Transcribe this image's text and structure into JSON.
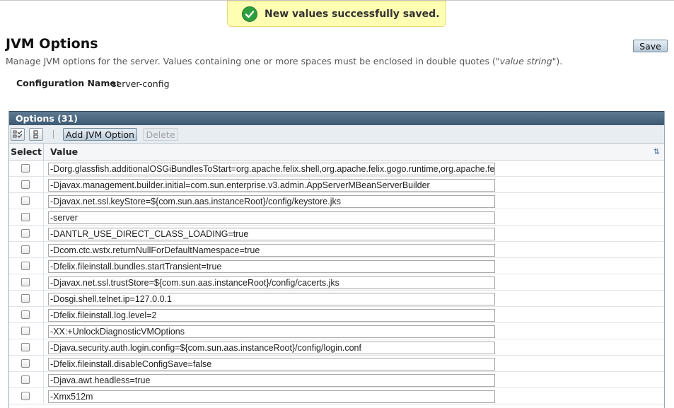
{
  "alert": {
    "message": "New values successfully saved."
  },
  "page": {
    "title": "JVM Options",
    "help_before": "Manage JVM options for the server. Values containing one or more spaces must be enclosed in double quotes (\"",
    "help_em": "value string",
    "help_after": "\").",
    "save_label": "Save"
  },
  "config": {
    "label": "Configuration Name:",
    "value": "server-config"
  },
  "table": {
    "title": "Options (31)",
    "add_label": "Add JVM Option",
    "delete_label": "Delete",
    "col_select": "Select",
    "col_value": "Value",
    "rows": [
      "-Dorg.glassfish.additionalOSGiBundlesToStart=org.apache.felix.shell,org.apache.felix.gogo.runtime,org.apache.felix.gogo.shell",
      "-Djavax.management.builder.initial=com.sun.enterprise.v3.admin.AppServerMBeanServerBuilder",
      "-Djavax.net.ssl.keyStore=${com.sun.aas.instanceRoot}/config/keystore.jks",
      "-server",
      "-DANTLR_USE_DIRECT_CLASS_LOADING=true",
      "-Dcom.ctc.wstx.returnNullForDefaultNamespace=true",
      "-Dfelix.fileinstall.bundles.startTransient=true",
      "-Djavax.net.ssl.trustStore=${com.sun.aas.instanceRoot}/config/cacerts.jks",
      "-Dosgi.shell.telnet.ip=127.0.0.1",
      "-Dfelix.fileinstall.log.level=2",
      "-XX:+UnlockDiagnosticVMOptions",
      "-Djava.security.auth.login.config=${com.sun.aas.instanceRoot}/config/login.conf",
      "-Dfelix.fileinstall.disableConfigSave=false",
      "-Djava.awt.headless=true",
      "-Xmx512m"
    ]
  }
}
